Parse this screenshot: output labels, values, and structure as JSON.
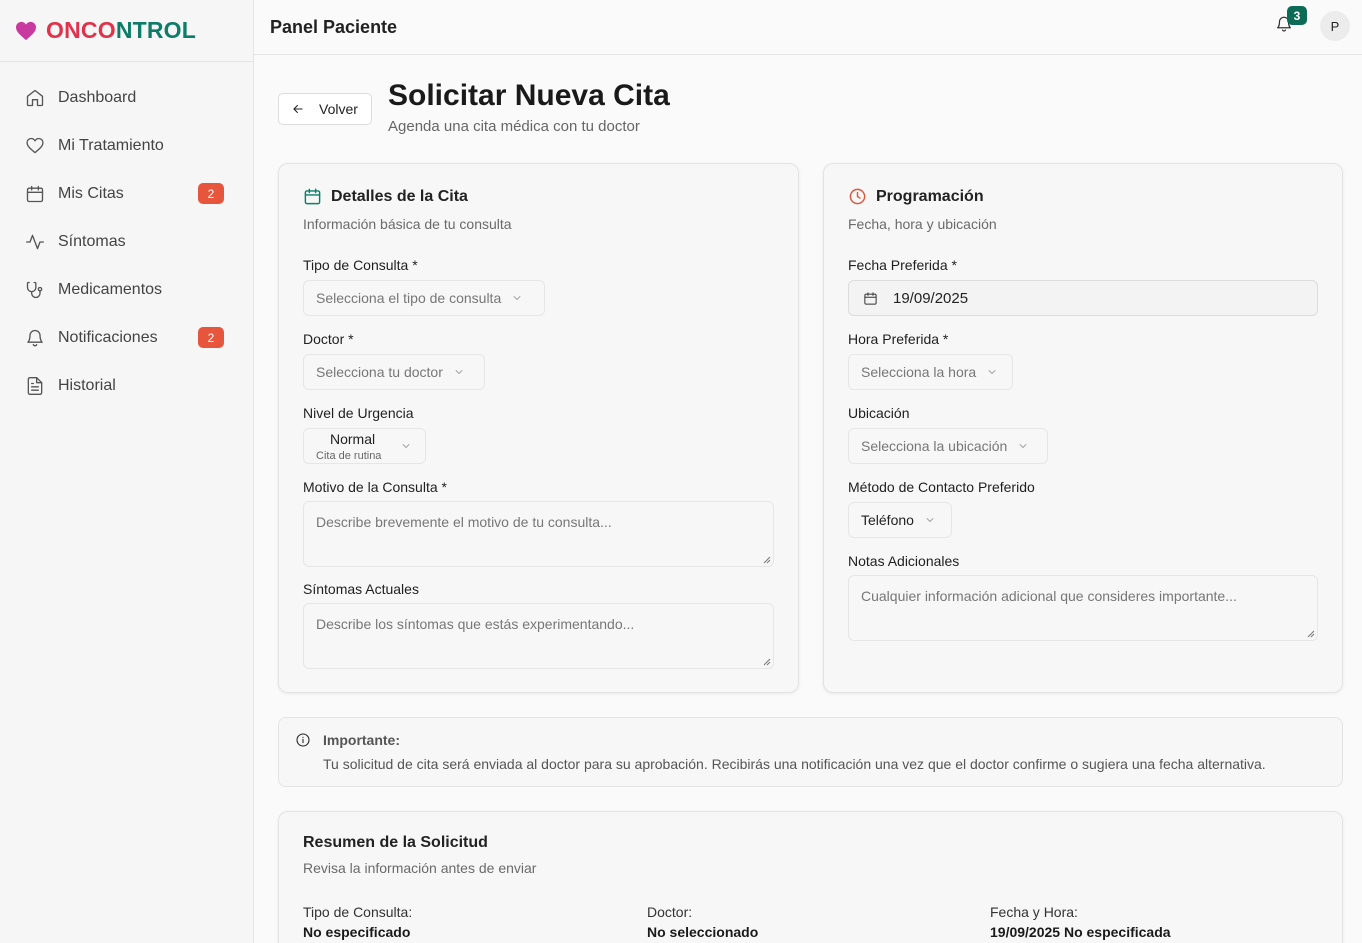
{
  "app": {
    "logo_part1": "ONCO",
    "logo_part2": "NTROL"
  },
  "sidebar": {
    "items": [
      {
        "label": "Dashboard",
        "icon": "home-icon"
      },
      {
        "label": "Mi Tratamiento",
        "icon": "heart-icon"
      },
      {
        "label": "Mis Citas",
        "icon": "calendar-icon",
        "badge": "2"
      },
      {
        "label": "Síntomas",
        "icon": "activity-icon"
      },
      {
        "label": "Medicamentos",
        "icon": "stethoscope-icon"
      },
      {
        "label": "Notificaciones",
        "icon": "bell-icon",
        "badge": "2"
      },
      {
        "label": "Historial",
        "icon": "file-text-icon"
      }
    ]
  },
  "header": {
    "title": "Panel Paciente",
    "notifications_count": "3",
    "avatar_initial": "P"
  },
  "page": {
    "back_label": "Volver",
    "title": "Solicitar Nueva Cita",
    "subtitle": "Agenda una cita médica con tu doctor"
  },
  "details": {
    "title": "Detalles de la Cita",
    "subtitle": "Información básica de tu consulta",
    "tipo_label": "Tipo de Consulta *",
    "tipo_placeholder": "Selecciona el tipo de consulta",
    "doctor_label": "Doctor *",
    "doctor_placeholder": "Selecciona tu doctor",
    "urgencia_label": "Nivel de Urgencia",
    "urgencia_value": "Normal",
    "urgencia_desc": "Cita de rutina",
    "motivo_label": "Motivo de la Consulta *",
    "motivo_placeholder": "Describe brevemente el motivo de tu consulta...",
    "sintomas_label": "Síntomas Actuales",
    "sintomas_placeholder": "Describe los síntomas que estás experimentando..."
  },
  "schedule": {
    "title": "Programación",
    "subtitle": "Fecha, hora y ubicación",
    "fecha_label": "Fecha Preferida *",
    "fecha_value": "19/09/2025",
    "hora_label": "Hora Preferida *",
    "hora_placeholder": "Selecciona la hora",
    "ubicacion_label": "Ubicación",
    "ubicacion_placeholder": "Selecciona la ubicación",
    "contacto_label": "Método de Contacto Preferido",
    "contacto_value": "Teléfono",
    "notas_label": "Notas Adicionales",
    "notas_placeholder": "Cualquier información adicional que consideres importante..."
  },
  "notice": {
    "title": "Importante:",
    "text": "Tu solicitud de cita será enviada al doctor para su aprobación. Recibirás una notificación una vez que el doctor confirme o sugiera una fecha alternativa."
  },
  "summary": {
    "title": "Resumen de la Solicitud",
    "subtitle": "Revisa la información antes de enviar",
    "tipo_label": "Tipo de Consulta:",
    "tipo_value": "No especificado",
    "doctor_label": "Doctor:",
    "doctor_value": "No seleccionado",
    "fecha_label": "Fecha y Hora:",
    "fecha_value": "19/09/2025 No especificada"
  },
  "colors": {
    "brand_red": "#e0324b",
    "brand_green": "#0e7c66",
    "badge_red": "#e8553d",
    "badge_green": "#0e6b55",
    "clock_orange": "#e0553a"
  }
}
